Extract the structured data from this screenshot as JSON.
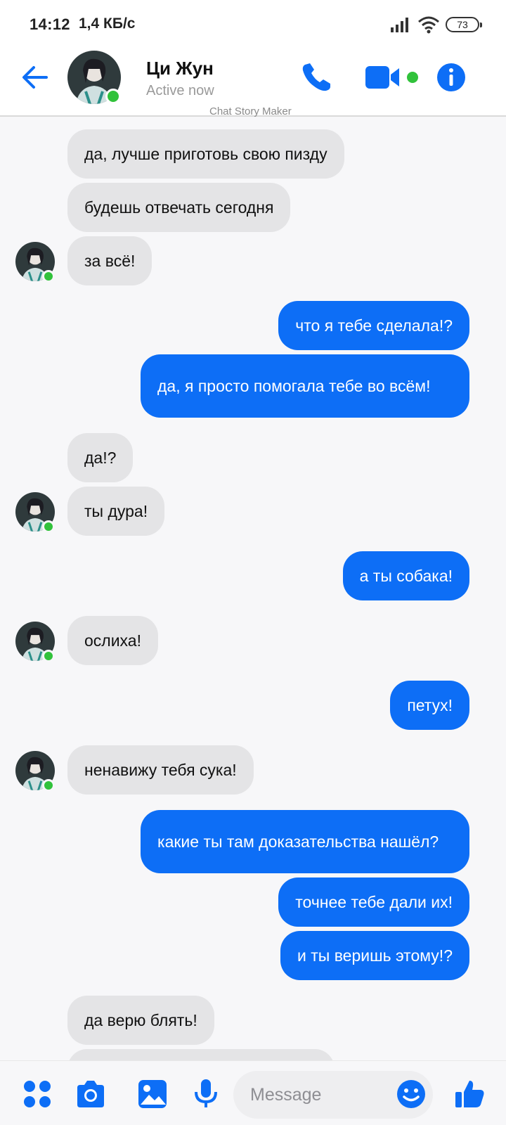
{
  "status_bar": {
    "time": "14:12",
    "speed": "1,4 КБ/с",
    "battery": "73"
  },
  "header": {
    "contact_name": "Ци Жун",
    "contact_status": "Active now",
    "watermark": "Chat Story Maker"
  },
  "messages": [
    {
      "side": "in",
      "text": "да, лучше приготовь свою пизду"
    },
    {
      "side": "in",
      "text": "будешь отвечать сегодня"
    },
    {
      "side": "in",
      "text": "за всё!"
    },
    {
      "side": "out",
      "text": "что я тебе сделала!?"
    },
    {
      "side": "out",
      "text": "да, я просто помогала тебе во всём!"
    },
    {
      "side": "in",
      "text": "да!?"
    },
    {
      "side": "in",
      "text": "ты дура!"
    },
    {
      "side": "out",
      "text": "а ты собака!"
    },
    {
      "side": "in",
      "text": "ослиха!"
    },
    {
      "side": "out",
      "text": "петух!"
    },
    {
      "side": "in",
      "text": "ненавижу тебя сука!"
    },
    {
      "side": "out",
      "text": "какие ты там доказательства нашёл?"
    },
    {
      "side": "out",
      "text": "точнее тебе дали их!"
    },
    {
      "side": "out",
      "text": "и ты веришь этому!?"
    },
    {
      "side": "in",
      "text": "да верю блять!"
    }
  ],
  "composer": {
    "placeholder": "Message"
  },
  "colors": {
    "accent": "#0d6ef6",
    "incoming_bubble": "#e4e4e6",
    "online": "#31c23b"
  },
  "icons": [
    "arrow-left-icon",
    "phone-icon",
    "video-camera-icon",
    "info-icon",
    "apps-grid-icon",
    "camera-icon",
    "image-icon",
    "microphone-icon",
    "smiley-icon",
    "thumbs-up-icon"
  ]
}
